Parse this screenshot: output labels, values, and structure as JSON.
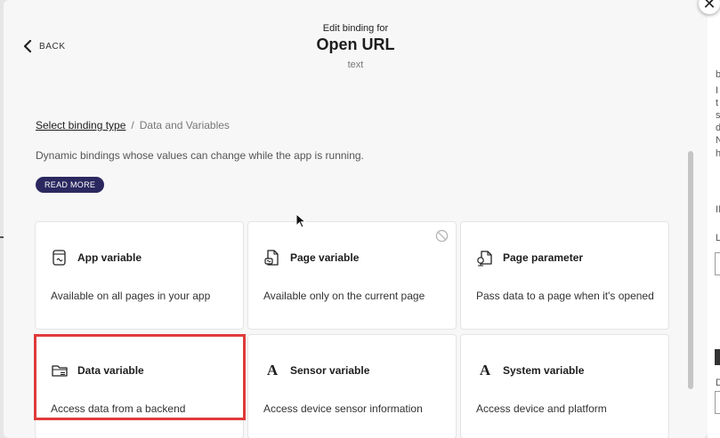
{
  "dialog": {
    "back_label": "BACK",
    "subtitle": "Edit binding for",
    "title": "Open URL",
    "type": "text",
    "close_glyph": "✕"
  },
  "breadcrumb": {
    "link": "Select binding type",
    "separator": "/",
    "current": "Data and Variables"
  },
  "description": "Dynamic bindings whose values can change while the app is running.",
  "read_more_label": "READ MORE",
  "cards": [
    {
      "title": "App variable",
      "description": "Available on all pages in your app",
      "icon": "app-variable-icon"
    },
    {
      "title": "Page variable",
      "description": "Available only on the current page",
      "icon": "page-variable-icon",
      "disabled_icon": "block-icon"
    },
    {
      "title": "Page parameter",
      "description": "Pass data to a page when it's opened",
      "icon": "page-parameter-icon"
    },
    {
      "title": "Data variable",
      "description": "Access data from a backend",
      "icon": "folder-icon"
    },
    {
      "title": "Sensor variable",
      "description": "Access device sensor information",
      "icon": "letter-a-icon",
      "letter": "A"
    },
    {
      "title": "System variable",
      "description": "Access device and platform",
      "icon": "letter-a-icon",
      "letter": "A"
    }
  ],
  "colors": {
    "accent": "#2b2860",
    "highlight": "#e03a3a",
    "background": "#f7f7f7"
  },
  "background_app": {
    "glyphs": [
      "b",
      "I",
      "t",
      "s",
      "d",
      "N",
      "h",
      "IN",
      "L",
      "D"
    ]
  }
}
